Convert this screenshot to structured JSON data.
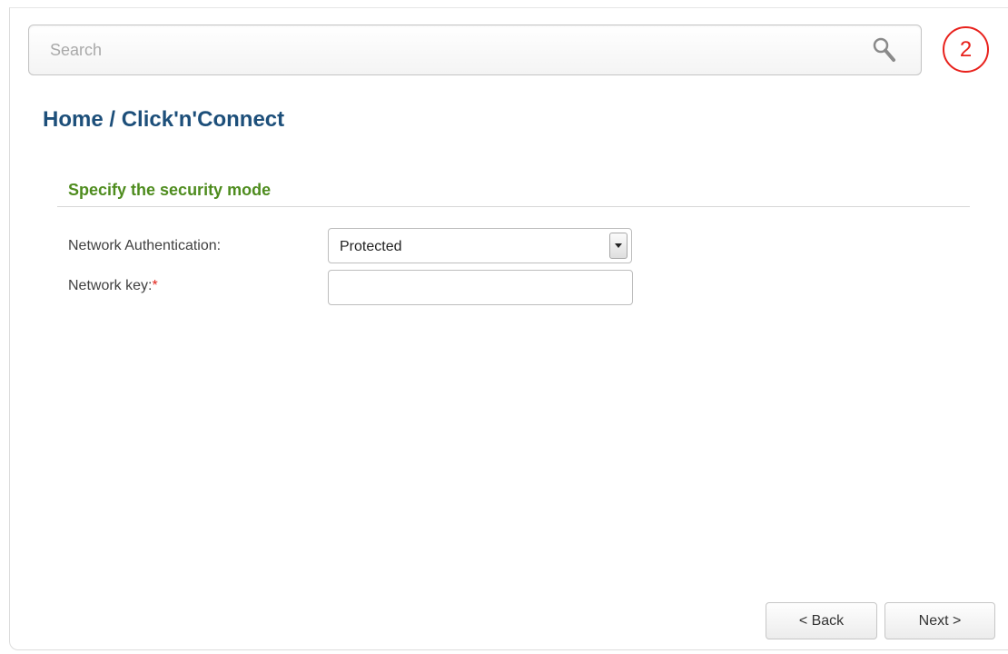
{
  "search": {
    "placeholder": "Search",
    "value": ""
  },
  "badge": {
    "number": "2"
  },
  "breadcrumb": {
    "home": "Home",
    "separator": " / ",
    "current": "Click'n'Connect"
  },
  "section": {
    "title": "Specify the security mode"
  },
  "form": {
    "network_auth": {
      "label": "Network Authentication:",
      "value": "Protected"
    },
    "network_key": {
      "label": "Network key:",
      "required_mark": "*",
      "value": ""
    }
  },
  "buttons": {
    "back": "< Back",
    "next": "Next >"
  },
  "colors": {
    "breadcrumb": "#1d4f7a",
    "section_title": "#4e8c1e",
    "badge": "#e8211c",
    "required": "#e2231a"
  }
}
